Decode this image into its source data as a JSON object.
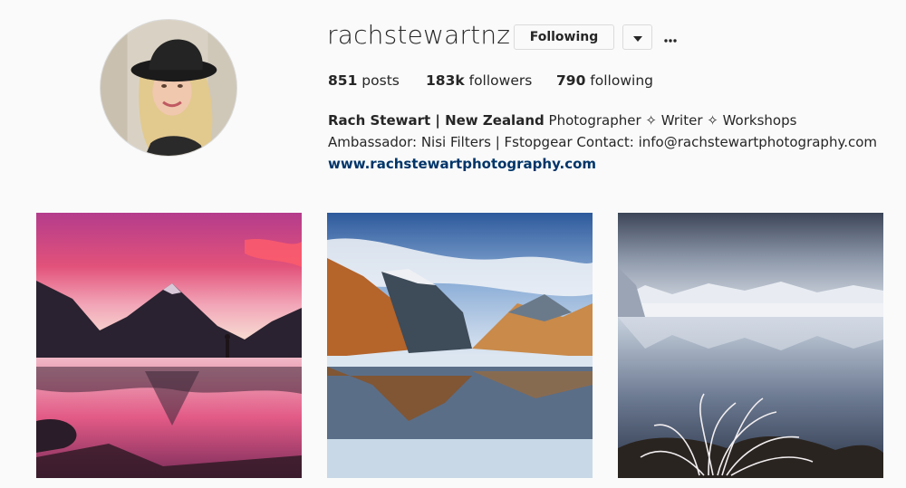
{
  "profile": {
    "username": "rachstewartnz",
    "following_label": "Following",
    "stats": {
      "posts_count": "851",
      "posts_label": "posts",
      "followers_count": "183k",
      "followers_label": "followers",
      "following_count": "790",
      "following_label": "following"
    },
    "bio": {
      "name": "Rach Stewart | New Zealand",
      "text": "Photographer ✧ Writer ✧ Workshops Ambassador: Nisi Filters | Fstopgear Contact: info@rachstewartphotography.com",
      "website": "www.rachstewartphotography.com"
    }
  },
  "icons": {
    "dropdown": "chevron-down-icon",
    "more": "more-options-icon"
  },
  "colors": {
    "link": "#003569",
    "border": "#dbdbdb",
    "background": "#fafafa"
  }
}
